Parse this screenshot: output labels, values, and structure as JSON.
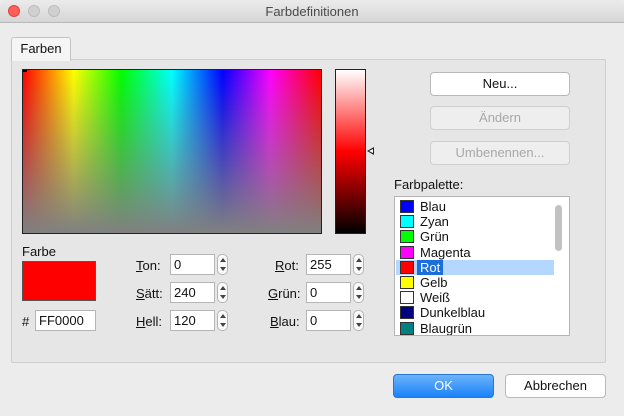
{
  "window": {
    "title": "Farbdefinitionen"
  },
  "tabs": [
    {
      "label": "Farben"
    }
  ],
  "color": {
    "label": "Farbe",
    "hex_prefix": "#",
    "hex": "FF0000",
    "swatch_color": "#ff0000"
  },
  "hsl": {
    "hue": {
      "key": "T",
      "rest": "on:",
      "value": "0"
    },
    "sat": {
      "key": "S",
      "rest": "ätt:",
      "value": "240"
    },
    "lum": {
      "key": "H",
      "rest": "ell:",
      "value": "120"
    }
  },
  "rgb": {
    "red": {
      "key": "R",
      "rest": "ot:",
      "value": "255"
    },
    "green": {
      "key": "G",
      "rest": "rün:",
      "value": "0"
    },
    "blue": {
      "key": "B",
      "rest": "lau:",
      "value": "0"
    }
  },
  "buttons": {
    "new": {
      "label": "Neu...",
      "enabled": true
    },
    "change": {
      "label": "Ändern",
      "enabled": false
    },
    "rename": {
      "label": "Umbenennen...",
      "enabled": false
    },
    "ok": {
      "label": "OK"
    },
    "cancel": {
      "label": "Abbrechen"
    }
  },
  "palette": {
    "label": "Farbpalette:",
    "items": [
      {
        "name": "Blau",
        "color": "#0000ff"
      },
      {
        "name": "Zyan",
        "color": "#00ffff"
      },
      {
        "name": "Grün",
        "color": "#00ff00"
      },
      {
        "name": "Magenta",
        "color": "#ff00ff"
      },
      {
        "name": "Rot",
        "color": "#ff0000",
        "selected": true
      },
      {
        "name": "Gelb",
        "color": "#ffff00"
      },
      {
        "name": "Weiß",
        "color": "#ffffff"
      },
      {
        "name": "Dunkelblau",
        "color": "#000080"
      },
      {
        "name": "Blaugrün",
        "color": "#008080"
      }
    ]
  }
}
